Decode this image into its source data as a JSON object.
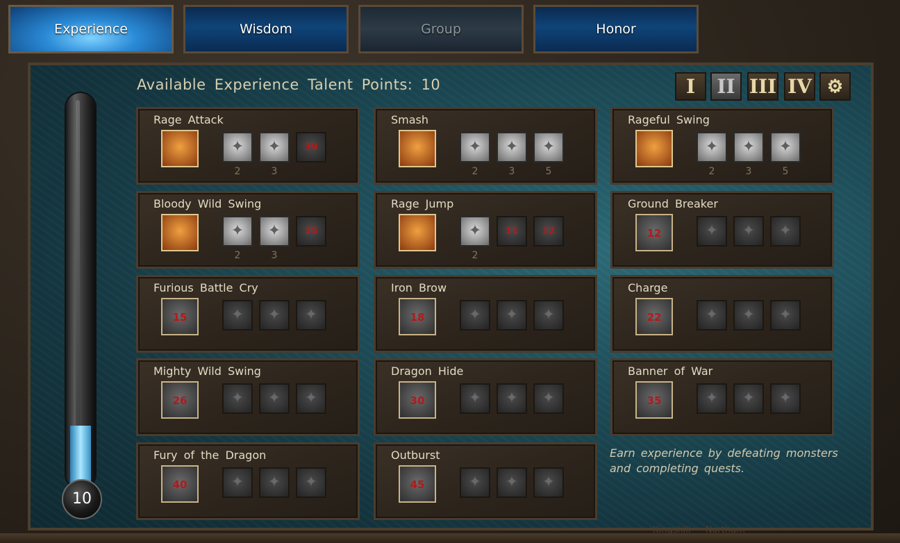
{
  "tabs": [
    {
      "label": "Experience",
      "state": "active"
    },
    {
      "label": "Wisdom",
      "state": "normal"
    },
    {
      "label": "Group",
      "state": "disabled"
    },
    {
      "label": "Honor",
      "state": "normal"
    }
  ],
  "points_title": "Available Experience Talent Points: 10",
  "level_orb": "10",
  "bar_fill_fraction": 0.16,
  "pages": [
    "I",
    "II",
    "III",
    "IV",
    "⚙"
  ],
  "active_page": "II",
  "talents": [
    {
      "title": "Rage Attack",
      "icon": "sword-slash-icon",
      "main_value": "",
      "main_lit": true,
      "subs": [
        {
          "v": "",
          "lit": true,
          "lvl": "2"
        },
        {
          "v": "",
          "lit": true,
          "lvl": "3"
        },
        {
          "v": "39",
          "lit": false,
          "lvl": ""
        }
      ]
    },
    {
      "title": "Smash",
      "icon": "smash-icon",
      "main_value": "",
      "main_lit": true,
      "subs": [
        {
          "v": "",
          "lit": true,
          "lvl": "2"
        },
        {
          "v": "",
          "lit": true,
          "lvl": "3"
        },
        {
          "v": "",
          "lit": true,
          "lvl": "5"
        }
      ]
    },
    {
      "title": "Rageful Swing",
      "icon": "fire-swing-icon",
      "main_value": "",
      "main_lit": true,
      "subs": [
        {
          "v": "",
          "lit": true,
          "lvl": "2"
        },
        {
          "v": "",
          "lit": true,
          "lvl": "3"
        },
        {
          "v": "",
          "lit": true,
          "lvl": "5"
        }
      ]
    },
    {
      "title": "Bloody Wild Swing",
      "icon": "whirl-icon",
      "main_value": "",
      "main_lit": true,
      "subs": [
        {
          "v": "",
          "lit": true,
          "lvl": "2"
        },
        {
          "v": "",
          "lit": true,
          "lvl": "3"
        },
        {
          "v": "15",
          "lit": false,
          "lvl": ""
        }
      ]
    },
    {
      "title": "Rage Jump",
      "icon": "jump-icon",
      "main_value": "",
      "main_lit": true,
      "subs": [
        {
          "v": "",
          "lit": true,
          "lvl": "2"
        },
        {
          "v": "11",
          "lit": false,
          "lvl": ""
        },
        {
          "v": "12",
          "lit": false,
          "lvl": ""
        }
      ]
    },
    {
      "title": "Ground Breaker",
      "icon": "ground-break-icon",
      "main_value": "12",
      "main_lit": false,
      "subs": [
        {
          "v": "",
          "lit": false,
          "lvl": ""
        },
        {
          "v": "",
          "lit": false,
          "lvl": ""
        },
        {
          "v": "",
          "lit": false,
          "lvl": ""
        }
      ]
    },
    {
      "title": "Furious Battle Cry",
      "icon": "battle-cry-icon",
      "main_value": "15",
      "main_lit": false,
      "subs": [
        {
          "v": "",
          "lit": false,
          "lvl": ""
        },
        {
          "v": "",
          "lit": false,
          "lvl": ""
        },
        {
          "v": "",
          "lit": false,
          "lvl": ""
        }
      ]
    },
    {
      "title": "Iron Brow",
      "icon": "iron-brow-icon",
      "main_value": "18",
      "main_lit": false,
      "subs": [
        {
          "v": "",
          "lit": false,
          "lvl": ""
        },
        {
          "v": "",
          "lit": false,
          "lvl": ""
        },
        {
          "v": "",
          "lit": false,
          "lvl": ""
        }
      ]
    },
    {
      "title": "Charge",
      "icon": "charge-icon",
      "main_value": "22",
      "main_lit": false,
      "subs": [
        {
          "v": "",
          "lit": false,
          "lvl": ""
        },
        {
          "v": "",
          "lit": false,
          "lvl": ""
        },
        {
          "v": "",
          "lit": false,
          "lvl": ""
        }
      ]
    },
    {
      "title": "Mighty Wild Swing",
      "icon": "mighty-swing-icon",
      "main_value": "26",
      "main_lit": false,
      "subs": [
        {
          "v": "",
          "lit": false,
          "lvl": ""
        },
        {
          "v": "",
          "lit": false,
          "lvl": ""
        },
        {
          "v": "",
          "lit": false,
          "lvl": ""
        }
      ]
    },
    {
      "title": "Dragon Hide",
      "icon": "dragon-hide-icon",
      "main_value": "30",
      "main_lit": false,
      "subs": [
        {
          "v": "",
          "lit": false,
          "lvl": ""
        },
        {
          "v": "",
          "lit": false,
          "lvl": ""
        },
        {
          "v": "",
          "lit": false,
          "lvl": ""
        }
      ]
    },
    {
      "title": "Banner of War",
      "icon": "banner-icon",
      "main_value": "35",
      "main_lit": false,
      "subs": [
        {
          "v": "",
          "lit": false,
          "lvl": ""
        },
        {
          "v": "",
          "lit": false,
          "lvl": ""
        },
        {
          "v": "",
          "lit": false,
          "lvl": ""
        }
      ]
    },
    {
      "title": "Fury of the Dragon",
      "icon": "dragon-fury-icon",
      "main_value": "40",
      "main_lit": false,
      "subs": [
        {
          "v": "",
          "lit": false,
          "lvl": ""
        },
        {
          "v": "",
          "lit": false,
          "lvl": ""
        },
        {
          "v": "",
          "lit": false,
          "lvl": ""
        }
      ]
    },
    {
      "title": "Outburst",
      "icon": "outburst-icon",
      "main_value": "45",
      "main_lit": false,
      "subs": [
        {
          "v": "",
          "lit": false,
          "lvl": ""
        },
        {
          "v": "",
          "lit": false,
          "lvl": ""
        },
        {
          "v": "",
          "lit": false,
          "lvl": ""
        }
      ]
    }
  ],
  "note": "Earn experience by defeating monsters and completing quests.",
  "footer": "Kingshill — Northam"
}
